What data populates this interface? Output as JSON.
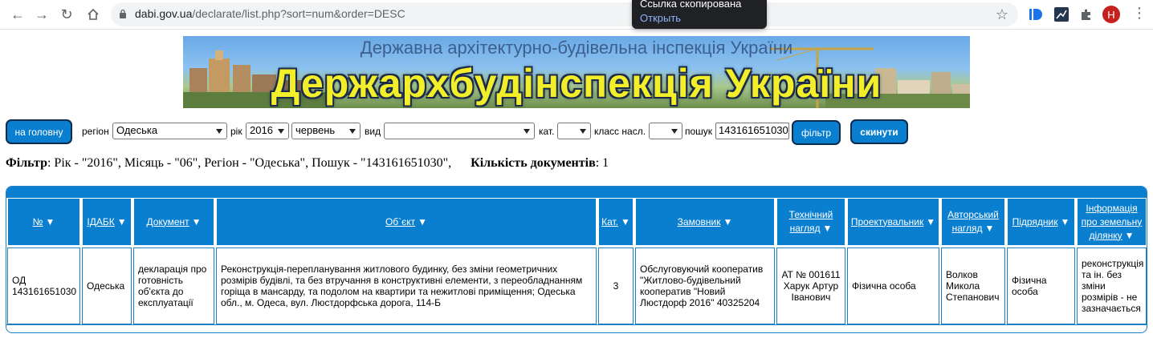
{
  "browser": {
    "url_host": "dabi.gov.ua",
    "url_path": "/declarate/list.php?sort=num&order=DESC",
    "avatar_letter": "H",
    "toast_title": "Ссылка скопирована",
    "toast_link": "Открыть"
  },
  "banner": {
    "subtitle": "Державна архітектурно-будівельна інспекція України",
    "title": "Держархбудінспекція України"
  },
  "filter": {
    "home_button": "на головну",
    "region_label": "регіон",
    "region_value": "Одеська",
    "year_label": "рік",
    "year_value": "2016",
    "month_value": "червень",
    "type_label": "вид",
    "type_value": "",
    "cat_label": "кат.",
    "cat_value": "",
    "class_label": "класс насл.",
    "class_value": "",
    "search_label": "пошук",
    "search_value": "143161651030",
    "filter_button": "фільтр",
    "reset_button": "скинути"
  },
  "summary": {
    "filter_label": "Фільтр",
    "filter_text": ": Рік - \"2016\", Місяць - \"06\", Регіон - \"Одеська\", Пошук - \"143161651030\",",
    "count_label": "Кількість документів",
    "count_value": ": 1"
  },
  "table": {
    "headers": [
      "№",
      "ІДАБК",
      "Документ",
      "Об`єкт",
      "Кат.",
      "Замовник",
      "Технічний нагляд",
      "Проектувальник",
      "Авторський нагляд",
      "Підрядник",
      "Інформація про земельну ділянку"
    ],
    "rows": [
      {
        "num": "ОД 143161651030",
        "idabk": "Одеська",
        "document": "декларація про готовність об'єкта до експлуатації",
        "object": "Реконструкція-перепланування житлового будинку, без зміни геометричних розмірів будівлі, та без втручання в конструктивні елементи, з переобладнанням горіща в мансарду, та подолом на квартири та нежитлові приміщення; Одеська обл., м. Одеса, вул. Люстдорфська дорога, 114-Б",
        "category": "3",
        "customer": "Обслуговуючий кооператив \"Житлово-будівельний кооператив \"Новий Люстдорф 2016\" 40325204",
        "tech_supervision": "АТ № 001611 Харук Артур Іванович",
        "designer": "Фізична особа",
        "author_supervision": "Волков Микола Степанович",
        "contractor": "Фізична особа",
        "land_info": "реконструкція та ін. без зміни розмірів - не зазначається"
      }
    ]
  },
  "colors": {
    "accent": "#0a7fd0",
    "button_border": "#0d2b4d",
    "banner_title": "#f2ef2a"
  }
}
